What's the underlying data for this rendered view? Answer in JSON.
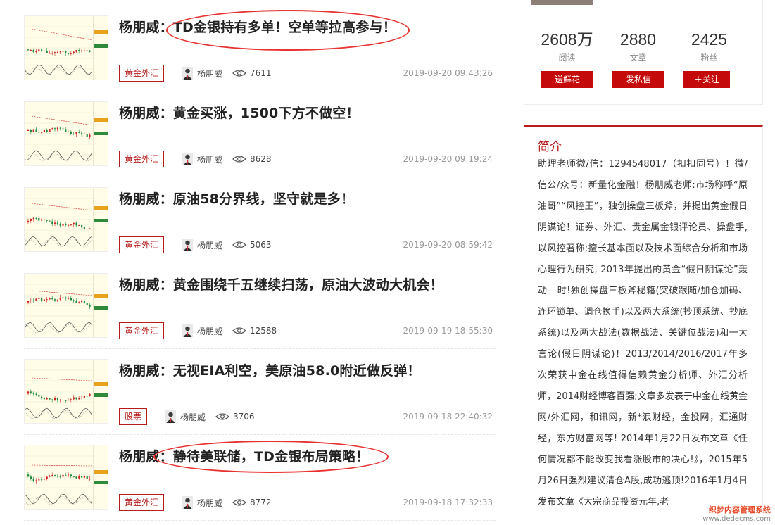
{
  "articles": [
    {
      "title": "杨朋威：TD金银持有多单！空单等拉高参与！",
      "tag": "黄金外汇",
      "author": "杨朋威",
      "views": "7611",
      "date": "2019-09-20 09:43:26"
    },
    {
      "title": "杨朋威：黄金买涨，1500下方不做空！",
      "tag": "黄金外汇",
      "author": "杨朋威",
      "views": "8628",
      "date": "2019-09-20 09:19:24"
    },
    {
      "title": "杨朋威：原油58分界线，坚守就是多！",
      "tag": "黄金外汇",
      "author": "杨朋威",
      "views": "5063",
      "date": "2019-09-20 08:59:42"
    },
    {
      "title": "杨朋威：黄金围绕千五继续扫荡，原油大波动大机会！",
      "tag": "黄金外汇",
      "author": "杨朋威",
      "views": "12588",
      "date": "2019-09-19 18:55:30"
    },
    {
      "title": "杨朋威：无视EIA利空，美原油58.0附近做反弹！",
      "tag": "股票",
      "author": "杨朋威",
      "views": "3706",
      "date": "2019-09-18 22:40:32"
    },
    {
      "title": "杨朋威：静待美联储，TD金银布局策略！",
      "tag": "黄金外汇",
      "author": "杨朋威",
      "views": "8772",
      "date": "2019-09-18 17:32:33"
    }
  ],
  "profile": {
    "stats": [
      {
        "num": "2608万",
        "label": "阅读"
      },
      {
        "num": "2880",
        "label": "文章"
      },
      {
        "num": "2425",
        "label": "粉丝"
      }
    ],
    "buttons": {
      "flower": "送鲜花",
      "message": "发私信",
      "follow": "＋关注"
    }
  },
  "intro": {
    "heading": "简介",
    "text": "助理老师微/信：1294548017（扣扣同号）！微/信公/众号：新量化金融！杨朋威老师:市场称呼“原油哥”“风控王”，独创操盘三板斧，并提出黄金假日阴谋论！证券、外汇、贵金属金银评论员、操盘手,以风控著称;擅长基本面以及技术面综合分析和市场心理行为研究, 2013年提出的黄金“假日阴谋论”轰动- -时!独创操盘三板斧秘籍(突破跟随/加仓加码、连环锁单、调仓换手)以及两大系统(抄顶系统、抄底系统)以及两大战法(数据战法、关键位战法)和一大言论(假日阴谋论)！2013/2014/2016/2017年多次荣获中金在线值得信赖黄金分析师、外汇分析师，2014财经博客百强;文章多发表于中金在线黄金网/外汇网，和讯网，新*浪财经，金投网，汇通财经，东方财富网等! 2014年1月22日发布文章《任何情况都不能改变我看涨股市的决心!》，2015年5月26日强烈建议清仓A股,成功逃顶!2016年1月4日发布文章《大宗商品投资元年,老"
  },
  "watermark": {
    "line1": "织梦内容管理系统",
    "line2": "www.dedecms.com"
  },
  "colors": {
    "accent": "#b71c1c",
    "button": "#c40a0a",
    "highlight_ring": "#e8322f"
  }
}
